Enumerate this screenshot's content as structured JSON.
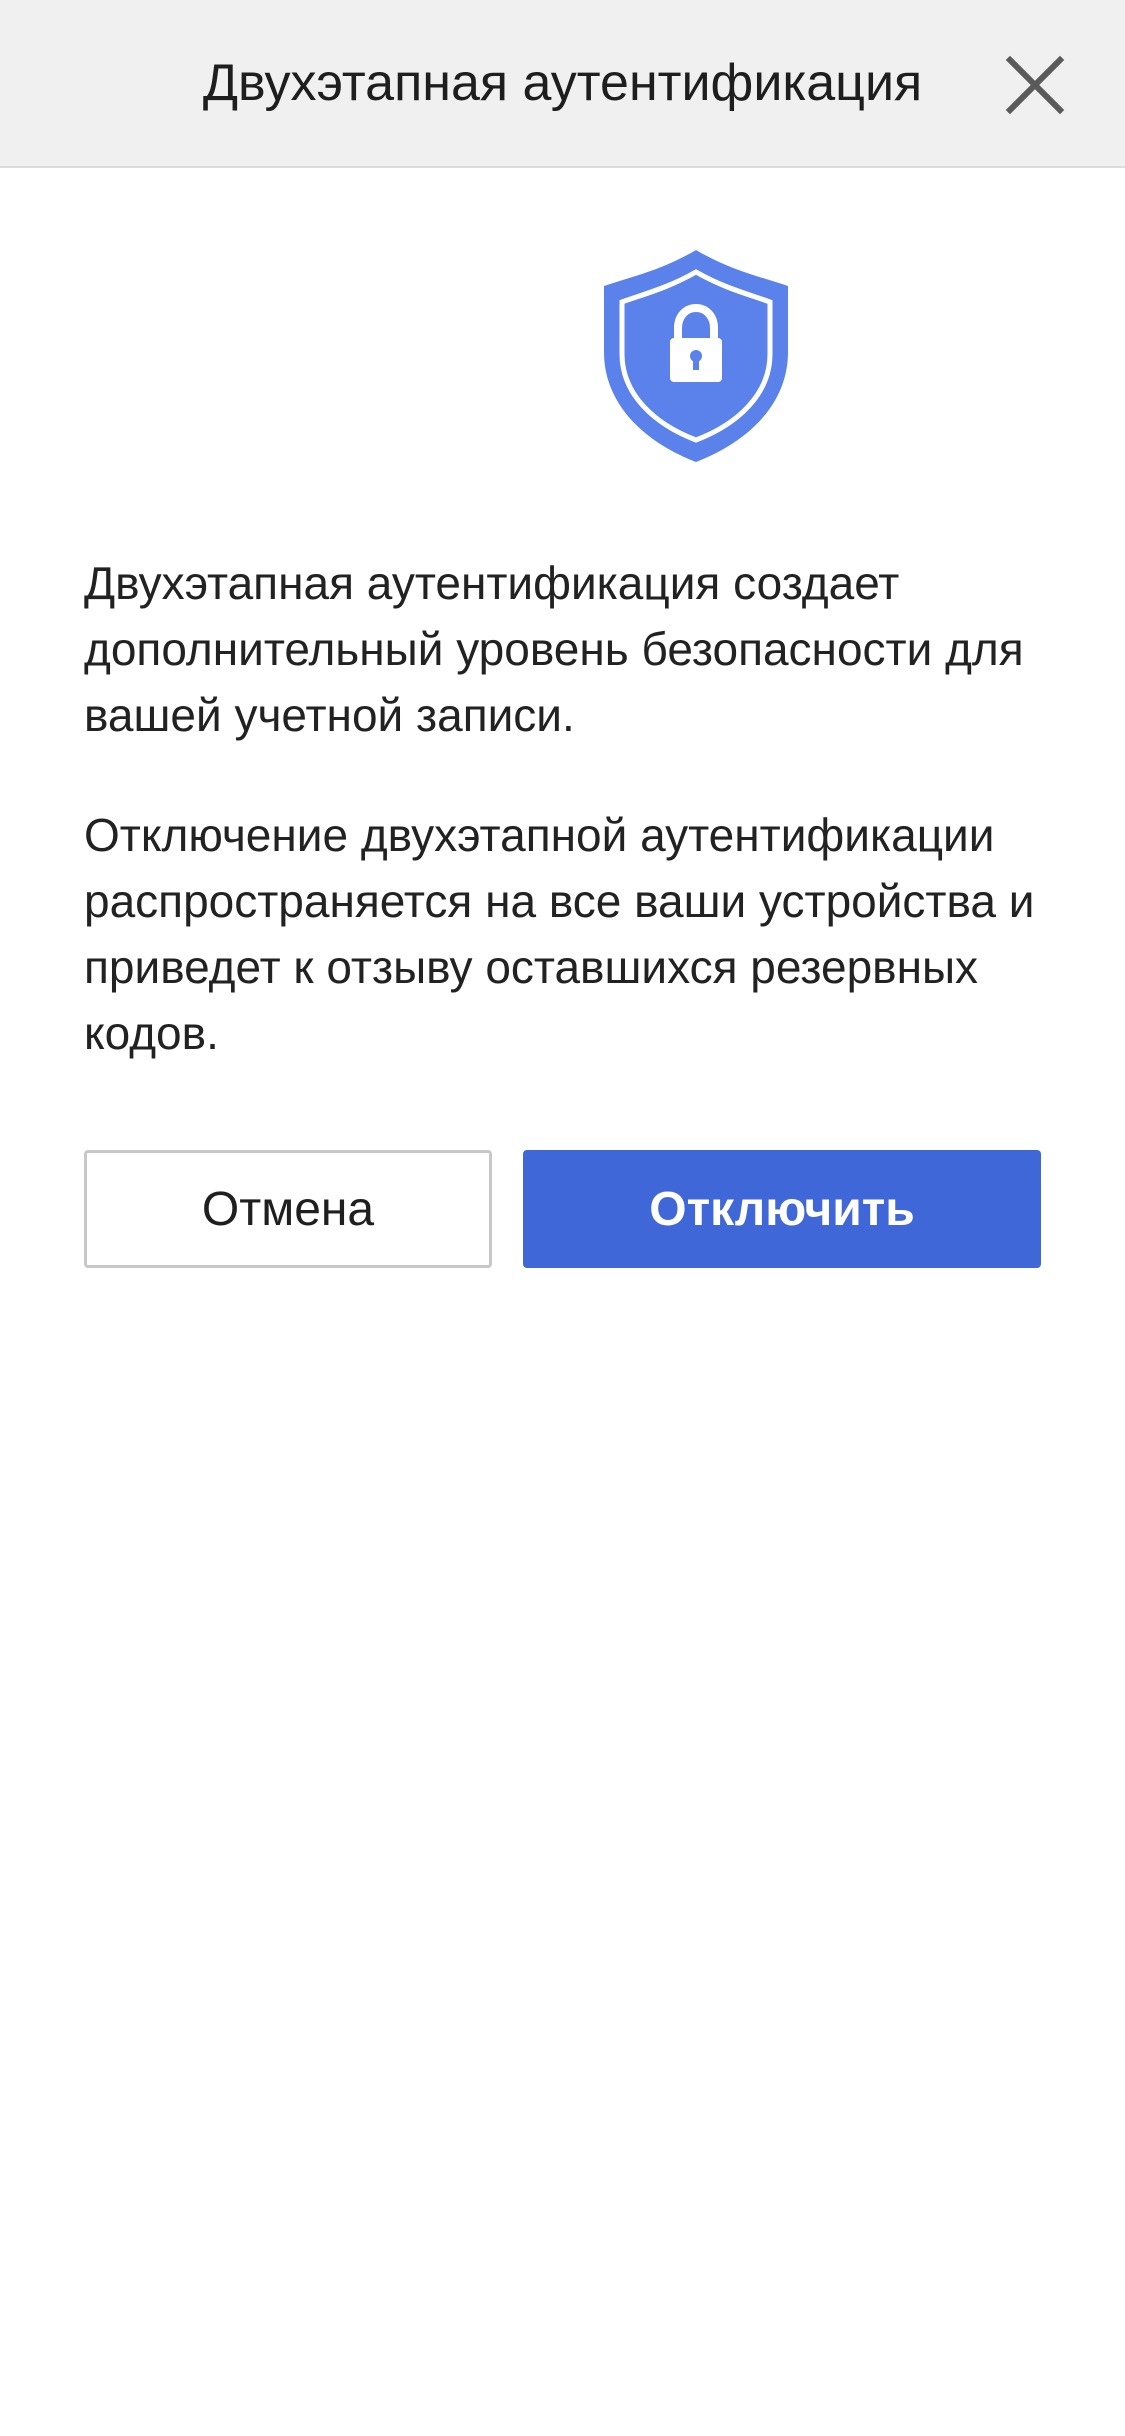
{
  "header": {
    "title": "Двухэтапная аутентификация",
    "close_icon": "close-icon"
  },
  "hero": {
    "icon": "shield-lock-icon",
    "color": "#5a82ea"
  },
  "content": {
    "paragraph_1": "Двухэтапная аутентификация создает дополнительный уровень безопасности для вашей учетной записи.",
    "paragraph_2": "Отключение двухэтапной аутентификации распространяется на все ваши устройства и приведет к отзыву оставшихся резервных кодов."
  },
  "actions": {
    "cancel_label": "Отмена",
    "disable_label": "Отключить",
    "primary_color": "#3f67d8"
  }
}
